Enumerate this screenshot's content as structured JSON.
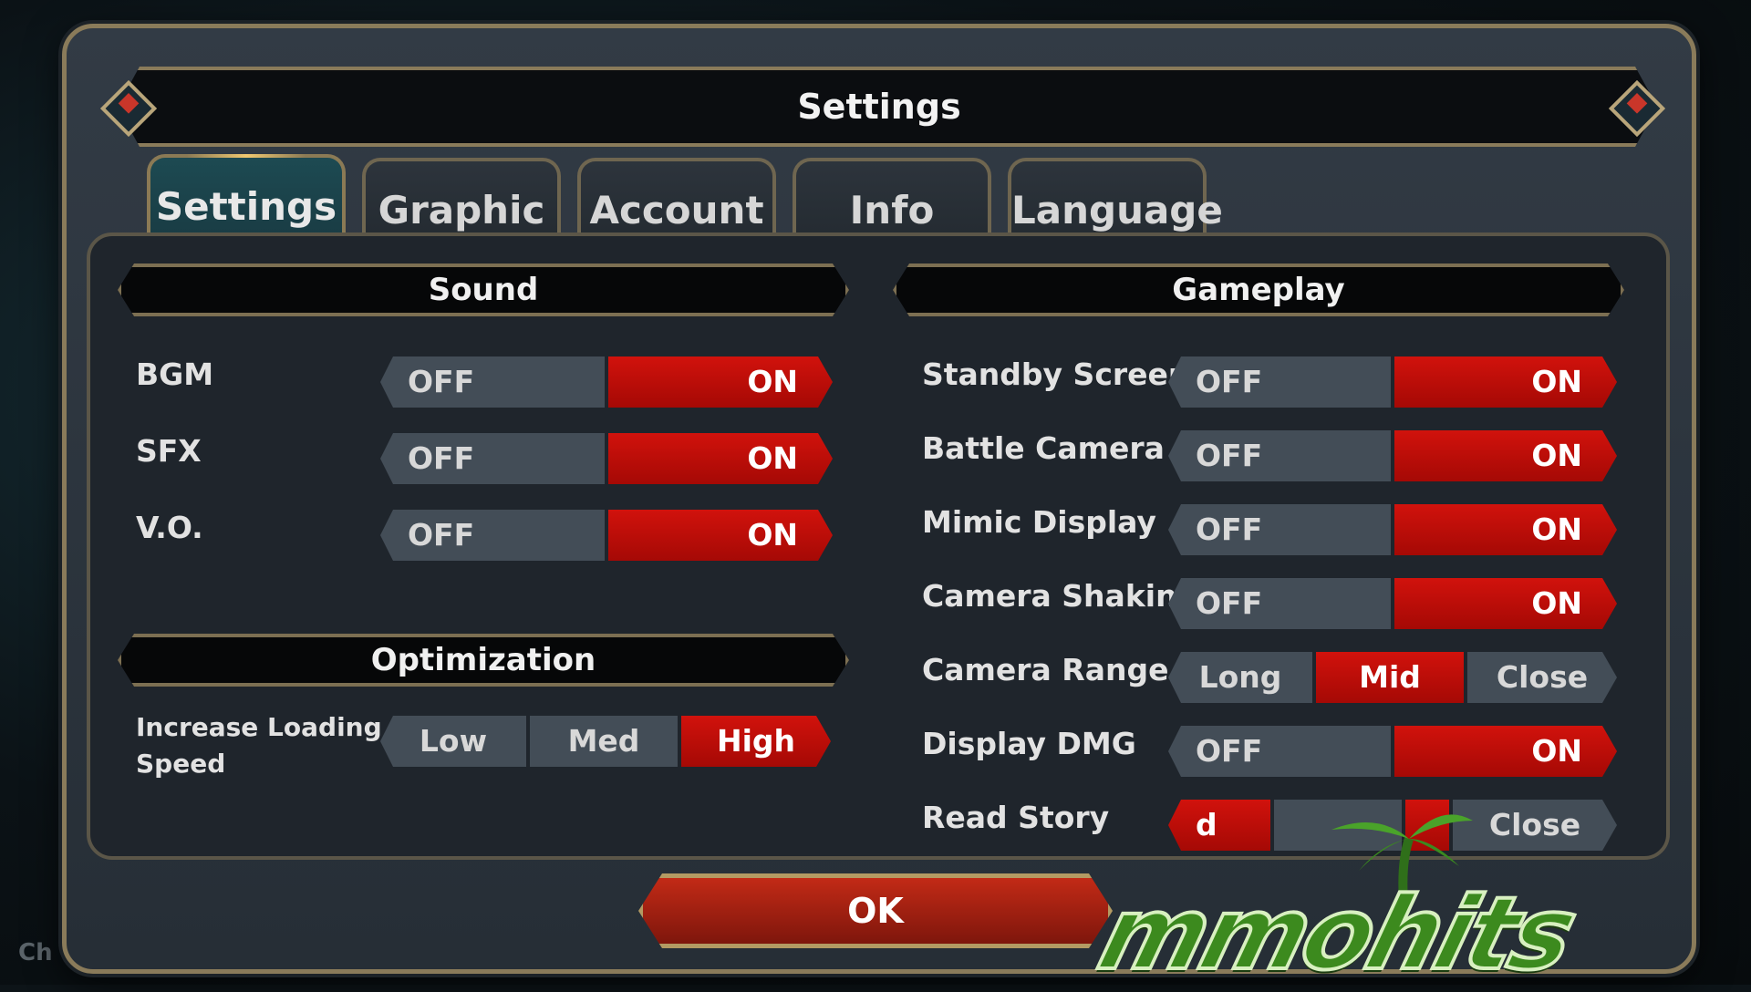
{
  "title": "Settings",
  "tabs": [
    "Settings",
    "Graphic",
    "Account",
    "Info",
    "Language"
  ],
  "active_tab": "Settings",
  "sound": {
    "header": "Sound",
    "rows": [
      {
        "label": "BGM",
        "off": "OFF",
        "on": "ON",
        "value": "ON"
      },
      {
        "label": "SFX",
        "off": "OFF",
        "on": "ON",
        "value": "ON"
      },
      {
        "label": "V.O.",
        "off": "OFF",
        "on": "ON",
        "value": "ON"
      }
    ]
  },
  "optimization": {
    "header": "Optimization",
    "label_line1": "Increase Loading",
    "label_line2": "Speed",
    "options": [
      "Low",
      "Med",
      "High"
    ],
    "value": "High"
  },
  "gameplay": {
    "header": "Gameplay",
    "rows": [
      {
        "label": "Standby Screen",
        "off": "OFF",
        "on": "ON",
        "value": "ON"
      },
      {
        "label": "Battle Camera",
        "off": "OFF",
        "on": "ON",
        "value": "ON"
      },
      {
        "label": "Mimic Display",
        "off": "OFF",
        "on": "ON",
        "value": "ON"
      },
      {
        "label": "Camera Shaking",
        "off": "OFF",
        "on": "ON",
        "value": "ON"
      }
    ],
    "camera_range": {
      "label": "Camera Range",
      "options": [
        "Long",
        "Mid",
        "Close"
      ],
      "value": "Mid"
    },
    "display_dmg": {
      "label": "Display DMG",
      "off": "OFF",
      "on": "ON",
      "value": "ON"
    },
    "read_story": {
      "label": "Read Story",
      "left": "d",
      "right": "Close"
    }
  },
  "ok_label": "OK",
  "background_text": "Ch",
  "watermark": "mmohits",
  "colors": {
    "accent_red": "#d1120c",
    "gold_border": "#8a7b5a",
    "panel": "#1f252c"
  }
}
